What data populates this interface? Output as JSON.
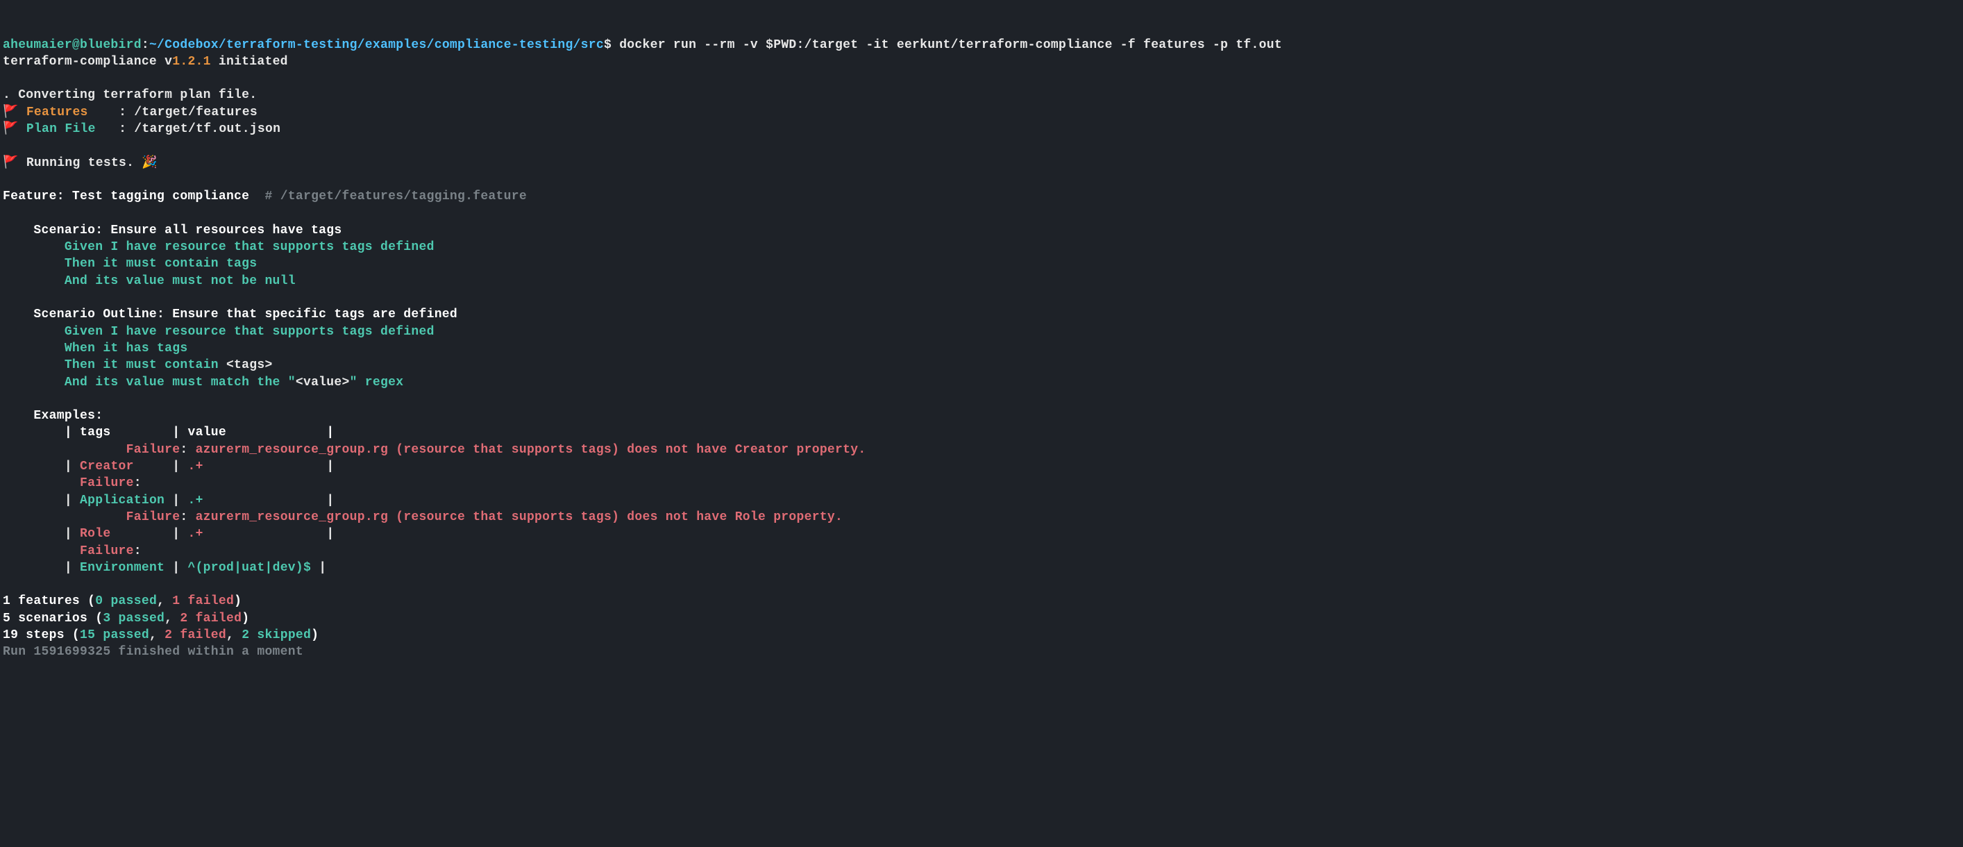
{
  "prompt": {
    "user": "aheumaier@bluebird",
    "colon": ":",
    "path": "~/Codebox/terraform-testing/examples/compliance-testing/src",
    "dollar": "$",
    "command": "docker run --rm -v $PWD:/target -it eerkunt/terraform-compliance -f features -p tf.out"
  },
  "init_line": {
    "prefix": "terraform-compliance v",
    "version": "1.2.1",
    "suffix": " initiated"
  },
  "converting": ". Converting terraform plan file.",
  "features_line": {
    "flag": "🚩",
    "label": "Features",
    "colon": ":",
    "path": "/target/features"
  },
  "plan_line": {
    "flag": "🚩",
    "label": "Plan File",
    "colon": ":",
    "path": "/target/tf.out.json"
  },
  "running_line": {
    "flag": "🚩",
    "text": "Running tests.",
    "emoji": "🎉"
  },
  "feature_header": {
    "label": "Feature: Test tagging compliance",
    "comment": "  # ",
    "path": "/target/features/tagging.feature"
  },
  "scenario1": {
    "title": "    Scenario: Ensure all resources have tags",
    "step1": "        Given I have resource that supports tags defined",
    "step2": "        Then it must contain tags",
    "step3": "        And its value must not be null"
  },
  "scenario2": {
    "title": "    Scenario Outline: Ensure that specific tags are defined",
    "step1": "        Given I have resource that supports tags defined",
    "step2": "        When it has tags",
    "step3_prefix": "        Then it must contain ",
    "step3_tag": "<tags>",
    "step4_prefix": "        And its value must match the \"",
    "step4_tag": "<value>",
    "step4_suffix": "\" regex"
  },
  "examples": {
    "title": "    Examples:",
    "header_row": {
      "pipe1": "        | ",
      "col1": "tags",
      "pipe2": "        | ",
      "col2": "value",
      "pipe3": "             |"
    },
    "failure1": {
      "indent": "                ",
      "label": "Failure",
      "colon": ": ",
      "msg": "azurerm_resource_group.rg (resource that supports tags) does not have Creator property."
    },
    "row1": {
      "pipe1": "        | ",
      "col1": "Creator",
      "pipe2": "     | ",
      "col2": ".+",
      "pipe3": "                |"
    },
    "failure1b": {
      "indent": "          ",
      "label": "Failure",
      "colon": ":"
    },
    "row2": {
      "pipe1": "        | ",
      "col1": "Application",
      "pipe2": " | ",
      "col2": ".+",
      "pipe3": "                |"
    },
    "failure2": {
      "indent": "                ",
      "label": "Failure",
      "colon": ": ",
      "msg": "azurerm_resource_group.rg (resource that supports tags) does not have Role property."
    },
    "row3": {
      "pipe1": "        | ",
      "col1": "Role",
      "pipe2": "        | ",
      "col2": ".+",
      "pipe3": "                |"
    },
    "failure3": {
      "indent": "          ",
      "label": "Failure",
      "colon": ":"
    },
    "row4": {
      "pipe1": "        | ",
      "col1": "Environment",
      "pipe2": " | ",
      "col2": "^(prod|uat|dev)$",
      "pipe3": " |"
    }
  },
  "summary": {
    "features": {
      "count": "1 features (",
      "passed": "0 passed",
      "sep1": ", ",
      "failed": "1 failed",
      "close": ")"
    },
    "scenarios": {
      "count": "5 scenarios (",
      "passed": "3 passed",
      "sep1": ", ",
      "failed": "2 failed",
      "close": ")"
    },
    "steps": {
      "count": "19 steps (",
      "passed": "15 passed",
      "sep1": ", ",
      "failed": "2 failed",
      "sep2": ", ",
      "skipped": "2 skipped",
      "close": ")"
    },
    "run": "Run 1591699325 finished within a moment"
  }
}
